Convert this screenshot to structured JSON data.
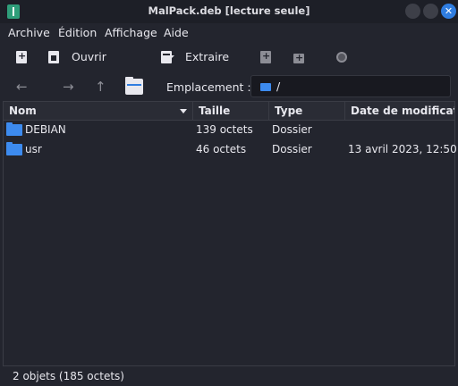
{
  "window": {
    "title": "MalPack.deb [lecture seule]"
  },
  "menu": [
    "Archive",
    "Édition",
    "Affichage",
    "Aide"
  ],
  "toolbar": {
    "open_label": "Ouvrir",
    "extract_label": "Extraire"
  },
  "location": {
    "label": "Emplacement :",
    "value": "/"
  },
  "columns": [
    "Nom",
    "Taille",
    "Type",
    "Date de modification"
  ],
  "rows": [
    {
      "name": "DEBIAN",
      "size": "139 octets",
      "type": "Dossier",
      "date": ""
    },
    {
      "name": "usr",
      "size": "46 octets",
      "type": "Dossier",
      "date": "13 avril 2023, 12:50"
    }
  ],
  "status": "2 objets (185 octets)",
  "colors": {
    "accent": "#2f7de0",
    "folder": "#3d8bef",
    "background": "#23252e"
  },
  "icons": [
    "app-icon",
    "new-archive-icon",
    "open-icon",
    "chevron-down-icon",
    "extract-icon",
    "add-file-icon",
    "add-folder-icon",
    "stop-icon",
    "back-icon",
    "forward-icon",
    "up-icon",
    "home-folder-icon",
    "folder-icon"
  ]
}
